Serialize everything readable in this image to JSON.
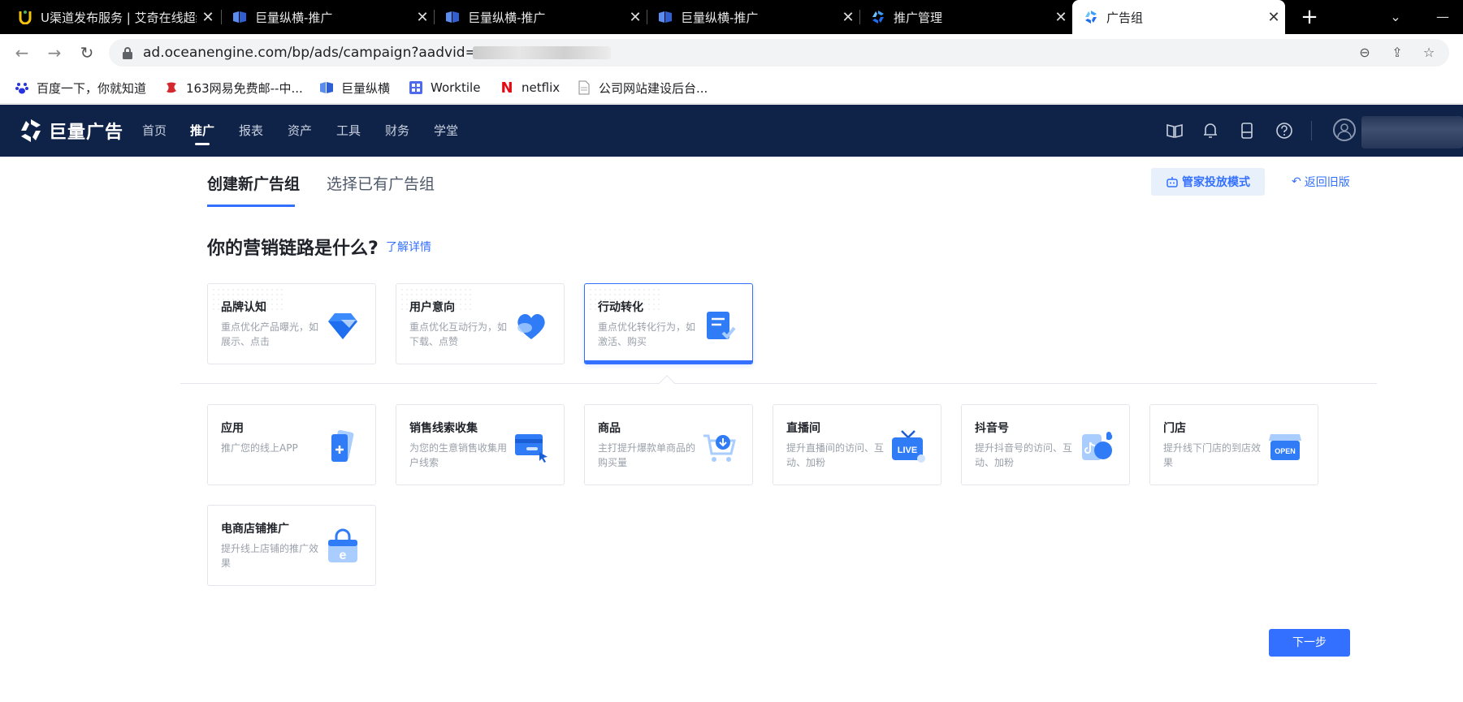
{
  "browser": {
    "tabs": [
      {
        "title": "U渠道发布服务 | 艾奇在线超级...",
        "icon": "u-channel-icon"
      },
      {
        "title": "巨量纵横-推广",
        "icon": "juliang-zongheng-icon"
      },
      {
        "title": "巨量纵横-推广",
        "icon": "juliang-zongheng-icon"
      },
      {
        "title": "巨量纵横-推广",
        "icon": "juliang-zongheng-icon"
      },
      {
        "title": "推广管理",
        "icon": "ocean-engine-icon"
      },
      {
        "title": "广告组",
        "icon": "ocean-engine-icon",
        "active": true
      }
    ],
    "url": "ad.oceanengine.com/bp/ads/campaign?aadvid=",
    "bookmarks": [
      {
        "label": "百度一下，你就知道",
        "icon": "baidu-icon"
      },
      {
        "label": "163网易免费邮--中...",
        "icon": "netease-icon"
      },
      {
        "label": "巨量纵横",
        "icon": "juliang-zongheng-icon"
      },
      {
        "label": "Worktile",
        "icon": "worktile-icon"
      },
      {
        "label": "netflix",
        "icon": "netflix-icon"
      },
      {
        "label": "公司网站建设后台...",
        "icon": "document-icon"
      }
    ]
  },
  "app": {
    "logo_text": "巨量广告",
    "nav": [
      "首页",
      "推广",
      "报表",
      "资产",
      "工具",
      "财务",
      "学堂"
    ],
    "active_nav": "推广"
  },
  "content": {
    "subtabs": [
      "创建新广告组",
      "选择已有广告组"
    ],
    "manager_mode": "管家投放模式",
    "back_old": "返回旧版",
    "question": "你的营销链路是什么?",
    "learn_more": "了解详情",
    "chains": [
      {
        "title": "品牌认知",
        "desc": "重点优化产品曝光，如展示、点击",
        "icon": "diamond-icon"
      },
      {
        "title": "用户意向",
        "desc": "重点优化互动行为，如下载、点赞",
        "icon": "heart-icon"
      },
      {
        "title": "行动转化",
        "desc": "重点优化转化行为，如激活、购买",
        "icon": "form-check-icon",
        "selected": true
      }
    ],
    "goals": [
      {
        "title": "应用",
        "desc": "推广您的线上APP",
        "icon": "app-phone-icon"
      },
      {
        "title": "销售线索收集",
        "desc": "为您的生意销售收集用户线索",
        "icon": "lead-card-icon"
      },
      {
        "title": "商品",
        "desc": "主打提升爆款单商品的购买量",
        "icon": "shopping-cart-icon"
      },
      {
        "title": "直播间",
        "desc": "提升直播间的访问、互动、加粉",
        "icon": "live-tv-icon"
      },
      {
        "title": "抖音号",
        "desc": "提升抖音号的访问、互动、加粉",
        "icon": "douyin-icon"
      },
      {
        "title": "门店",
        "desc": "提升线下门店的到店效果",
        "icon": "store-open-icon"
      },
      {
        "title": "电商店铺推广",
        "desc": "提升线上店铺的推广效果",
        "icon": "shop-bag-icon"
      }
    ],
    "live_badge": "LIVE",
    "open_badge": "OPEN",
    "next": "下一步"
  }
}
